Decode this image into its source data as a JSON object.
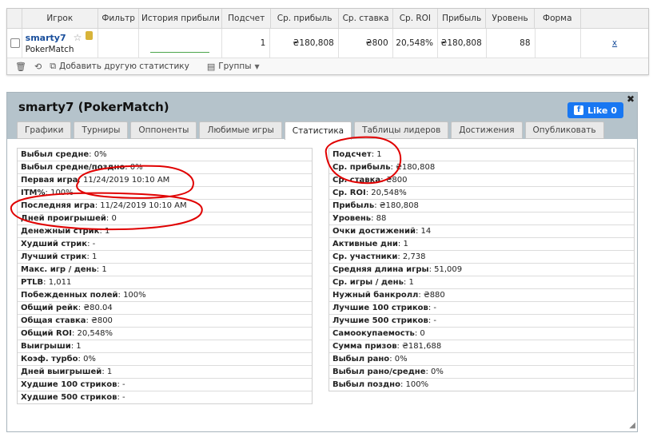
{
  "grid": {
    "headers": [
      "Игрок",
      "Фильтр",
      "История прибыли",
      "Подсчет",
      "Ср. прибыль",
      "Ср. ставка",
      "Ср. ROI",
      "Прибыль",
      "Уровень",
      "Форма"
    ],
    "row": {
      "player": "smarty7",
      "site": "PokerMatch",
      "count": "1",
      "avg_profit": "₴180,808",
      "avg_stake": "₴800",
      "avg_roi": "20,548%",
      "profit": "₴180,808",
      "level": "88",
      "remove": "x"
    },
    "footer": {
      "add_stat": "Добавить другую статистику",
      "groups": "Группы"
    }
  },
  "panel": {
    "title": "smarty7 (PokerMatch)",
    "like_label": "Like 0",
    "tabs": [
      "Графики",
      "Турниры",
      "Оппоненты",
      "Любимые игры",
      "Статистика",
      "Таблицы лидеров",
      "Достижения",
      "Опубликовать"
    ],
    "active_tab": "Статистика",
    "left_stats": [
      {
        "label": "Выбыл средне",
        "value": "0%"
      },
      {
        "label": "Выбыл средне/поздно",
        "value": "0%"
      },
      {
        "label": "Первая игра",
        "value": "11/24/2019 10:10 AM"
      },
      {
        "label": "ITM%",
        "value": "100%"
      },
      {
        "label": "Последняя игра",
        "value": "11/24/2019 10:10 AM"
      },
      {
        "label": "Дней проигрышей",
        "value": "0"
      },
      {
        "label": "Денежный стрик",
        "value": "1"
      },
      {
        "label": "Худший стрик",
        "value": "-"
      },
      {
        "label": "Лучший стрик",
        "value": "1"
      },
      {
        "label": "Макс. игр / день",
        "value": "1"
      },
      {
        "label": "PTLB",
        "value": "1,011"
      },
      {
        "label": "Побежденных полей",
        "value": "100%"
      },
      {
        "label": "Общий рейк",
        "value": "₴80.04"
      },
      {
        "label": "Общая ставка",
        "value": "₴800"
      },
      {
        "label": "Общий ROI",
        "value": "20,548%"
      },
      {
        "label": "Выигрыши",
        "value": "1"
      },
      {
        "label": "Коэф. турбо",
        "value": "0%"
      },
      {
        "label": "Дней выигрышей",
        "value": "1"
      },
      {
        "label": "Худшие 100 стриков",
        "value": "-"
      },
      {
        "label": "Худшие 500 стриков",
        "value": "-"
      }
    ],
    "right_stats": [
      {
        "label": "Подсчет",
        "value": "1"
      },
      {
        "label": "Ср. прибыль",
        "value": "₴180,808"
      },
      {
        "label": "Ср. ставка",
        "value": "₴800"
      },
      {
        "label": "Ср. ROI",
        "value": "20,548%"
      },
      {
        "label": "Прибыль",
        "value": "₴180,808"
      },
      {
        "label": "Уровень",
        "value": "88"
      },
      {
        "label": "Очки достижений",
        "value": "14"
      },
      {
        "label": "Активные дни",
        "value": "1"
      },
      {
        "label": "Ср. участники",
        "value": "2,738"
      },
      {
        "label": "Средняя длина игры",
        "value": "51,009"
      },
      {
        "label": "Ср. игры / день",
        "value": "1"
      },
      {
        "label": "Нужный банкролл",
        "value": "₴880"
      },
      {
        "label": "Лучшие 100 стриков",
        "value": "-"
      },
      {
        "label": "Лучшие 500 стриков",
        "value": "-"
      },
      {
        "label": "Самоокупаемость",
        "value": "0"
      },
      {
        "label": "Сумма призов",
        "value": "₴181,688"
      },
      {
        "label": "Выбыл рано",
        "value": "0%"
      },
      {
        "label": "Выбыл рано/средне",
        "value": "0%"
      },
      {
        "label": "Выбыл поздно",
        "value": "100%"
      }
    ]
  },
  "colors": {
    "annotation": "#e00000",
    "panel_header": "#b5c3cb",
    "like": "#1877f2",
    "link": "#1a4f9c"
  }
}
